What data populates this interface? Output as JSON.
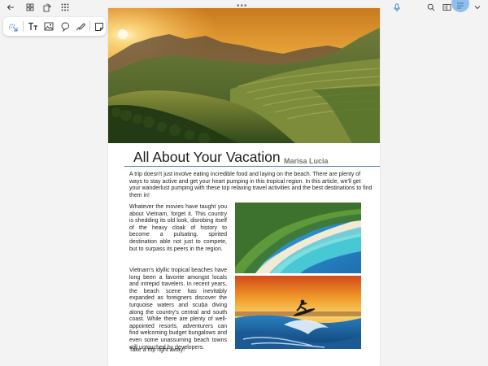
{
  "toolbar": {
    "back": "back-arrow-icon",
    "grid": "grid-view-icon",
    "rotate": "rotate-icon",
    "apps": "apps-icon",
    "more": "•••",
    "mic": "microphone-icon",
    "search": "search-icon",
    "reading": "reading-mode-icon",
    "menu": "menu-icon",
    "expand": "chevron-down-icon"
  },
  "annotation_tools": [
    "lasso-select-icon",
    "text-icon",
    "image-icon",
    "shape-icon",
    "pen-icon",
    "sticky-note-icon"
  ],
  "article": {
    "title": "All About Your Vacation",
    "author": "Marisa Lucia",
    "intro": "A trip doesn't just involve eating incredible food and laying on the beach. There are plenty of ways to stay active and get your heart pumping in this tropical region. In this article, we'll get your wanderlust pumping with these top  relaxing travel activities and the best destinations to find them in!",
    "para1": "Whatever the movies have taught you about Vietnam, forget it. This country is shedding its old look, disrobing itself of the heavy cloak of history to become a pulsating, spirited destination able not just to compete, but to surpass its peers in the region.",
    "para2": "Vietnam's idyllic tropical beaches have long been a favorite amongst locals and intrepid travelers. In recent years, the beach scene has inevitably expanded as foreigners discover the turquoise waters and scuba diving along the country's central and south coast. While there are plenty of well-appointed resorts, adventurers can find welcoming budget bungalows and even some unassuming beach towns still untouched by developers.",
    "closing": "Take a trip right away!"
  },
  "colors": {
    "accent": "#4a7fc6",
    "active_button": "#7fb6ea"
  }
}
